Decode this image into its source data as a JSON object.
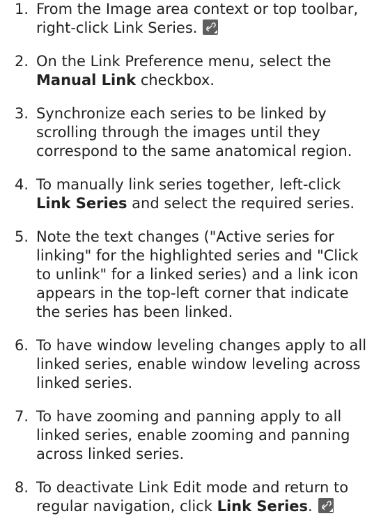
{
  "steps": [
    {
      "num": "1.",
      "parts": [
        {
          "t": "From the Image area context or top toolbar, right-click Link Series."
        }
      ],
      "icon": "link-series-icon"
    },
    {
      "num": "2.",
      "parts": [
        {
          "t": "On the Link Preference menu, select the "
        },
        {
          "t": "Manual Link",
          "b": true
        },
        {
          "t": " checkbox."
        }
      ]
    },
    {
      "num": "3.",
      "parts": [
        {
          "t": "Synchronize each series to be linked by scrolling through the images until they correspond to the same anatomical region."
        }
      ]
    },
    {
      "num": "4.",
      "parts": [
        {
          "t": "To manually link series together, left-click "
        },
        {
          "t": "Link Series",
          "b": true
        },
        {
          "t": " and select the required series."
        }
      ]
    },
    {
      "num": "5.",
      "parts": [
        {
          "t": "Note the text changes (\"Active series for linking\" for the highlighted series and \"Click to unlink\" for a linked series) and a link icon appears in the top-left corner that indicate the series has been linked."
        }
      ]
    },
    {
      "num": "6.",
      "parts": [
        {
          "t": "To have window leveling changes apply to all linked series, enable window leveling across linked series."
        }
      ]
    },
    {
      "num": "7.",
      "parts": [
        {
          "t": "To have zooming and panning apply to all linked series, enable zooming and panning across linked series."
        }
      ]
    },
    {
      "num": "8.",
      "parts": [
        {
          "t": "To deactivate Link Edit mode and return to regular navigation, click "
        },
        {
          "t": "Link Series",
          "b": true
        },
        {
          "t": "."
        }
      ],
      "icon": "link-series-icon"
    }
  ]
}
